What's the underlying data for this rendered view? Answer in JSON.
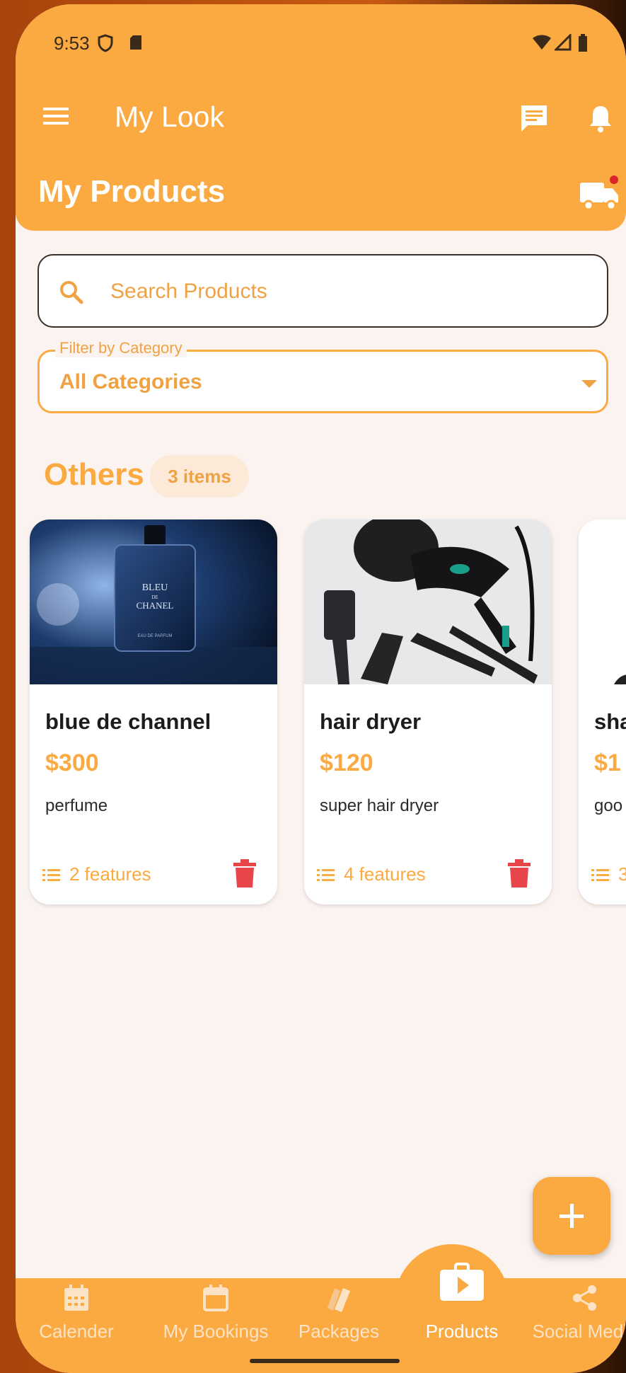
{
  "status_bar": {
    "time": "9:53"
  },
  "app_bar": {
    "title": "My Look"
  },
  "page": {
    "title": "My Products"
  },
  "search": {
    "placeholder": "Search Products"
  },
  "filter": {
    "label": "Filter by Category",
    "value": "All Categories"
  },
  "section": {
    "title": "Others",
    "count_badge": "3 items"
  },
  "products": [
    {
      "name": "blue de channel",
      "price": "$300",
      "description": "perfume",
      "features": "2 features",
      "image": "perfume-bottle-photo"
    },
    {
      "name": "hair dryer",
      "price": "$120",
      "description": "super hair dryer",
      "features": "4 features",
      "image": "hair-dryer-photo"
    },
    {
      "name": "sha",
      "price": "$1",
      "description": "goo",
      "features": "3",
      "image": "product-photo"
    }
  ],
  "product_image_text": {
    "brand": "BLEU",
    "sub": "DE",
    "maker": "CHANEL",
    "small": "EAU DE PARFUM"
  },
  "nav": [
    {
      "label": "Calender",
      "icon": "calendar-grid-icon"
    },
    {
      "label": "My Bookings",
      "icon": "calendar-icon"
    },
    {
      "label": "Packages",
      "icon": "packages-icon"
    },
    {
      "label": "Products",
      "icon": "shopping-bag-play-icon",
      "active": true
    },
    {
      "label": "Social Media",
      "icon": "share-icon"
    }
  ],
  "colors": {
    "primary": "#fbaa41",
    "background": "#fbf3ef",
    "delete": "#e8454a",
    "text": "#1c1c1c"
  }
}
